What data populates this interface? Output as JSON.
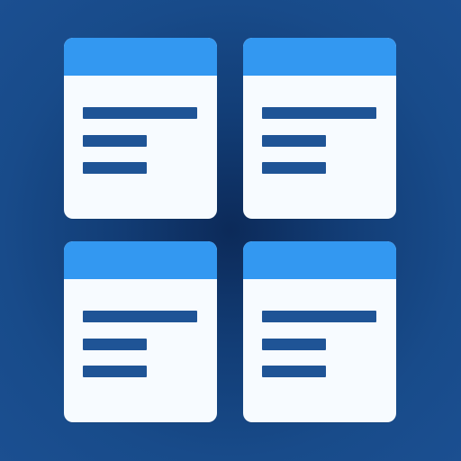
{
  "icon": {
    "name": "document-grid-icon",
    "background_color": "#184b8a",
    "card_color": "#f7fbff",
    "header_color": "#3398f1",
    "line_color": "#1f5496",
    "cards": [
      {
        "name": "document-card-top-left",
        "lines": 3
      },
      {
        "name": "document-card-top-right",
        "lines": 3
      },
      {
        "name": "document-card-bottom-left",
        "lines": 3
      },
      {
        "name": "document-card-bottom-right",
        "lines": 3
      }
    ]
  }
}
